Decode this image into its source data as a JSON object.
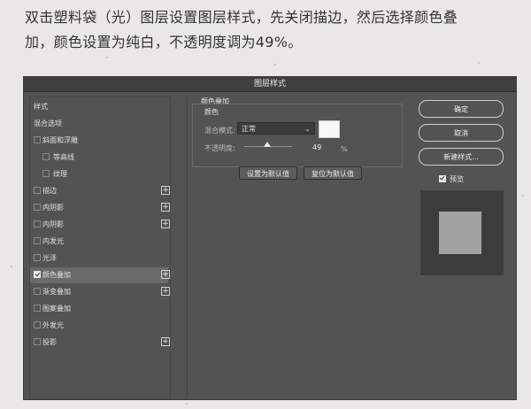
{
  "instruction": {
    "line1": "双击塑料袋（光）图层设置图层样式，先关闭描边，然后选择颜色叠",
    "line2": "加，颜色设置为纯白，不透明度调为49%。"
  },
  "dialog": {
    "title": "图层样式",
    "left_list": [
      {
        "label": "样式",
        "type": "header"
      },
      {
        "label": "混合选项",
        "type": "header"
      },
      {
        "label": "斜面和浮雕",
        "checked": false,
        "plus": false,
        "indent": false
      },
      {
        "label": "等高线",
        "checked": false,
        "plus": false,
        "indent": true
      },
      {
        "label": "纹理",
        "checked": false,
        "plus": false,
        "indent": true
      },
      {
        "label": "描边",
        "checked": false,
        "plus": true,
        "indent": false
      },
      {
        "label": "内阴影",
        "checked": false,
        "plus": true,
        "indent": false
      },
      {
        "label": "内阴影",
        "checked": false,
        "plus": true,
        "indent": false
      },
      {
        "label": "内发光",
        "checked": false,
        "plus": false,
        "indent": false
      },
      {
        "label": "光泽",
        "checked": false,
        "plus": false,
        "indent": false
      },
      {
        "label": "颜色叠加",
        "checked": true,
        "plus": true,
        "indent": false,
        "selected": true
      },
      {
        "label": "渐变叠加",
        "checked": false,
        "plus": true,
        "indent": false
      },
      {
        "label": "图案叠加",
        "checked": false,
        "plus": false,
        "indent": false
      },
      {
        "label": "外发光",
        "checked": false,
        "plus": false,
        "indent": false
      },
      {
        "label": "投影",
        "checked": false,
        "plus": true,
        "indent": false
      }
    ],
    "color_overlay": {
      "section_title": "颜色叠加",
      "group_title": "颜色",
      "blend_label": "混合模式:",
      "blend_value": "正常",
      "opacity_label": "不透明度:",
      "opacity_value": "49",
      "opacity_unit": "%",
      "opacity_fraction": 0.49,
      "swatch_color": "#f7f7f7",
      "btn_default_set": "设置为默认值",
      "btn_default_reset": "复位为默认值"
    },
    "right_buttons": {
      "ok": "确定",
      "cancel": "取消",
      "new_style": "新建样式...",
      "preview": "预览"
    }
  }
}
